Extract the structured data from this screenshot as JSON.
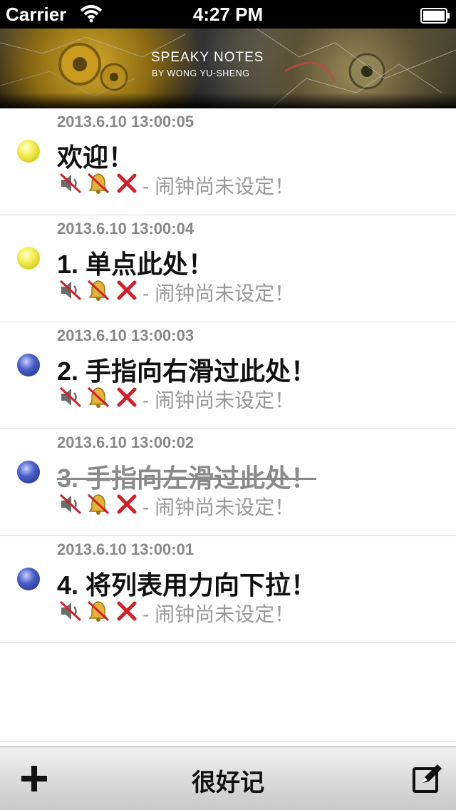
{
  "status_bar": {
    "carrier": "Carrier",
    "time": "4:27 PM"
  },
  "banner": {
    "title": "SPEAKY NOTES",
    "subtitle": "BY WONG YU-SHENG"
  },
  "notes": [
    {
      "date": "2013.6.10 13:00:05",
      "title": "欢迎！",
      "status": "- 闹钟尚未设定！",
      "dot": "yellow",
      "done": false
    },
    {
      "date": "2013.6.10 13:00:04",
      "title": "1. 单点此处！",
      "status": "- 闹钟尚未设定！",
      "dot": "yellow",
      "done": false
    },
    {
      "date": "2013.6.10 13:00:03",
      "title": "2. 手指向右滑过此处！",
      "status": "- 闹钟尚未设定！",
      "dot": "blue",
      "done": false
    },
    {
      "date": "2013.6.10 13:00:02",
      "title": "3. 手指向左滑过此处！",
      "status": "- 闹钟尚未设定！",
      "dot": "blue",
      "done": true
    },
    {
      "date": "2013.6.10 13:00:01",
      "title": "4. 将列表用力向下拉！",
      "status": "- 闹钟尚未设定！",
      "dot": "blue",
      "done": false
    }
  ],
  "toolbar": {
    "title": "很好记",
    "add_icon": "plus-icon",
    "compose_icon": "compose-icon"
  },
  "colors": {
    "dot_yellow": "#f3ef5a",
    "dot_blue": "#4a5fc8",
    "delete_red": "#d0202a"
  }
}
